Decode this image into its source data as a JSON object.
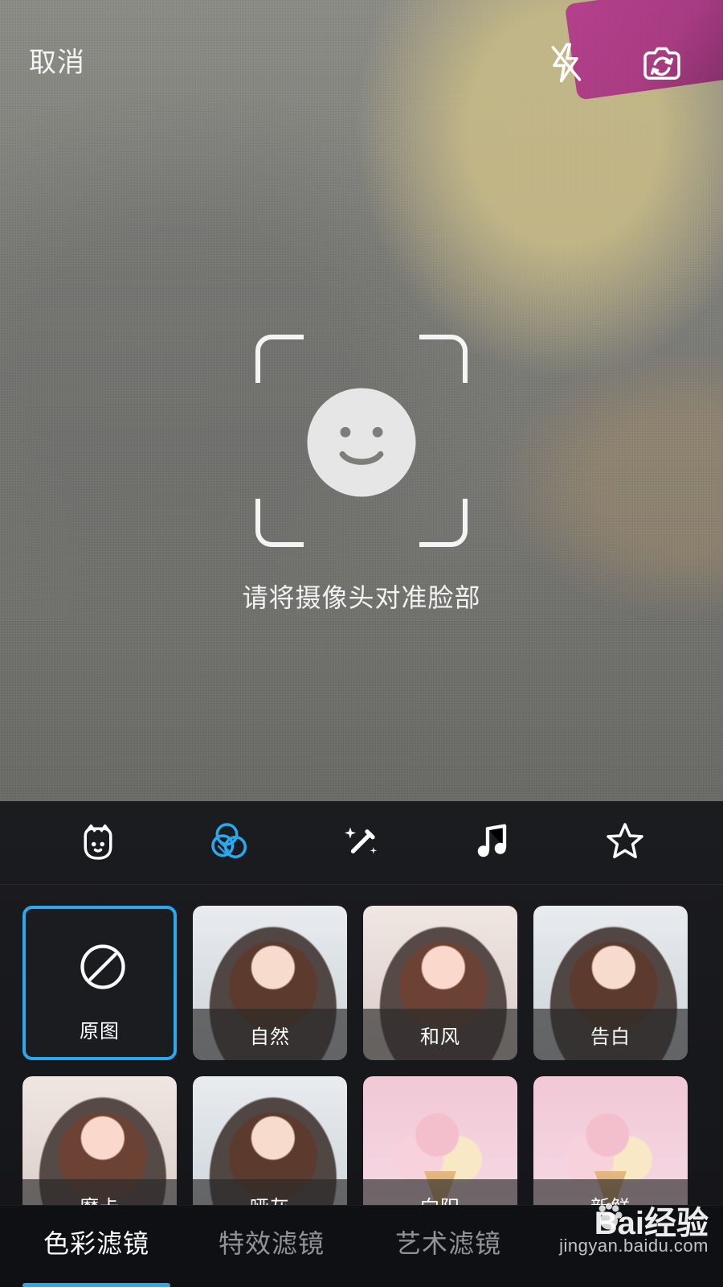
{
  "top_bar": {
    "cancel_label": "取消",
    "flash_icon": "flash-off-icon",
    "switch_camera_icon": "switch-camera-icon"
  },
  "face_guide": {
    "instruction": "请将摄像头对准脸部",
    "smile_icon": "smile-face-icon"
  },
  "toolbar": {
    "tools": [
      {
        "name": "sticker",
        "icon": "sticker-icon",
        "active": false
      },
      {
        "name": "filter",
        "icon": "filter-icon",
        "active": true
      },
      {
        "name": "beauty",
        "icon": "magic-wand-icon",
        "active": false
      },
      {
        "name": "music",
        "icon": "music-note-icon",
        "active": false
      },
      {
        "name": "favorites",
        "icon": "star-icon",
        "active": false
      }
    ],
    "accent_color": "#2aa8f0"
  },
  "filters": {
    "items": [
      {
        "label": "原图",
        "selected": true,
        "icon": "none-icon"
      },
      {
        "label": "自然",
        "selected": false
      },
      {
        "label": "和风",
        "selected": false
      },
      {
        "label": "告白",
        "selected": false
      },
      {
        "label": "摩卡",
        "selected": false
      },
      {
        "label": "哑灰",
        "selected": false
      },
      {
        "label": "向阳",
        "selected": false
      },
      {
        "label": "新鲜",
        "selected": false
      }
    ]
  },
  "tabs": {
    "items": [
      {
        "label": "色彩滤镜",
        "active": true
      },
      {
        "label": "特效滤镜",
        "active": false
      },
      {
        "label": "艺术滤镜",
        "active": false
      }
    ]
  },
  "watermark": {
    "brand": "Bai经验",
    "url": "jingyan.baidu.com"
  }
}
